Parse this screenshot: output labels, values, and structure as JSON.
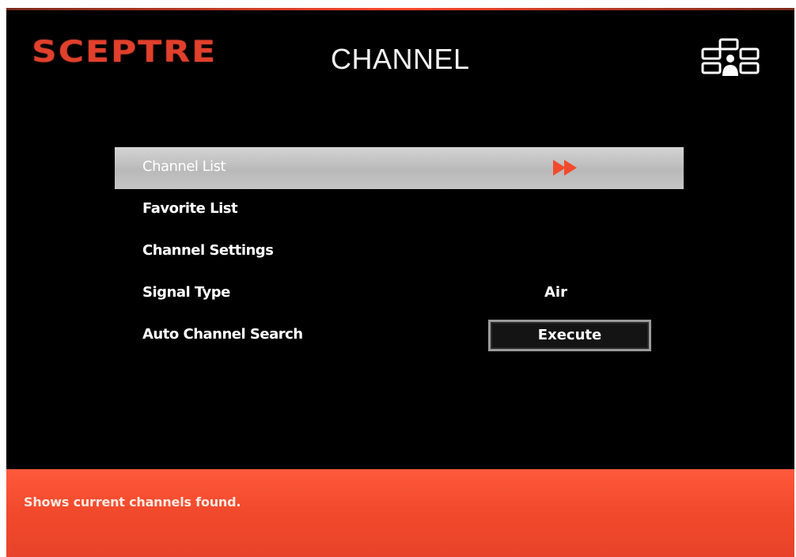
{
  "header": {
    "brand": "SCEPTRE",
    "title": "CHANNEL",
    "network_icon": "network-icon"
  },
  "menu": {
    "items": [
      {
        "label": "Channel List",
        "selected": true,
        "icon": "double-arrow-right-icon"
      },
      {
        "label": "Favorite List"
      },
      {
        "label": "Channel Settings"
      },
      {
        "label": "Signal Type",
        "value": "Air"
      },
      {
        "label": "Auto Channel Search",
        "button": "Execute"
      }
    ]
  },
  "help": {
    "text": "Shows current channels found."
  },
  "colors": {
    "brand": "#e0402c",
    "accent_arrow": "#f24a2c",
    "help_bar": "#f24a2c",
    "selected_row": "#c6c6c6",
    "background": "#000000"
  }
}
